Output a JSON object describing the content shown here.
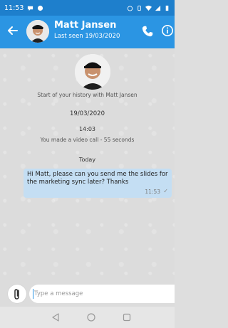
{
  "status_bar": {
    "time": "11:53"
  },
  "header": {
    "contact_name": "Matt Jansen",
    "last_seen": "Last seen 19/03/2020"
  },
  "chat": {
    "history_start": "Start of your history with Matt Jansen",
    "date": "19/03/2020",
    "call_time": "14:03",
    "call_text": "You made a video call - 55 seconds",
    "today_label": "Today",
    "messages": [
      {
        "text": "Hi Matt, please can you send me the slides for the marketing sync later? Thanks",
        "time": "11:53",
        "status": "sent"
      }
    ]
  },
  "composer": {
    "placeholder": "Type a message"
  },
  "colors": {
    "header": "#2b95e3",
    "status_bar": "#1e7fcc",
    "outgoing_bubble": "#c4def3",
    "chat_background": "#dcdcdc"
  },
  "icons": [
    "back-arrow-icon",
    "phone-icon",
    "info-icon",
    "paperclip-icon",
    "nav-back-icon",
    "nav-home-icon",
    "nav-recents-icon"
  ]
}
